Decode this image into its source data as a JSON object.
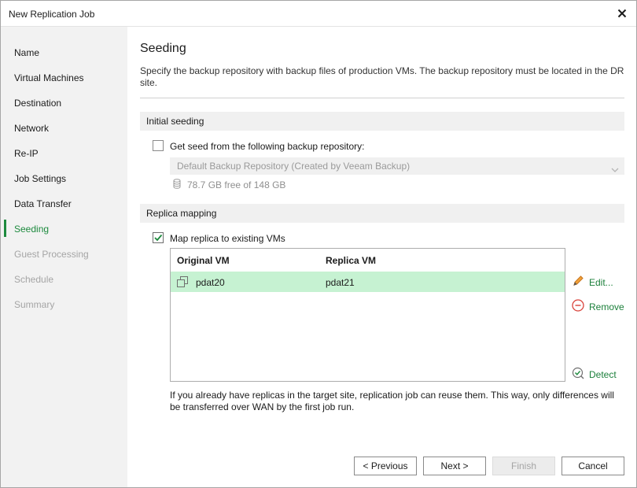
{
  "window": {
    "title": "New Replication Job"
  },
  "sidebar": {
    "items": [
      {
        "label": "Name",
        "state": "normal"
      },
      {
        "label": "Virtual Machines",
        "state": "normal"
      },
      {
        "label": "Destination",
        "state": "normal"
      },
      {
        "label": "Network",
        "state": "normal"
      },
      {
        "label": "Re-IP",
        "state": "normal"
      },
      {
        "label": "Job Settings",
        "state": "normal"
      },
      {
        "label": "Data Transfer",
        "state": "normal"
      },
      {
        "label": "Seeding",
        "state": "active"
      },
      {
        "label": "Guest Processing",
        "state": "disabled"
      },
      {
        "label": "Schedule",
        "state": "disabled"
      },
      {
        "label": "Summary",
        "state": "disabled"
      }
    ]
  },
  "page": {
    "title": "Seeding",
    "description": "Specify the backup repository with backup files of production VMs. The backup repository must be located in the DR site."
  },
  "initial_seeding": {
    "header": "Initial seeding",
    "checkbox_label": "Get seed from the following backup repository:",
    "checked": false,
    "repository_value": "Default Backup Repository (Created by Veeam Backup)",
    "free_space": "78.7 GB free of 148 GB"
  },
  "replica_mapping": {
    "header": "Replica mapping",
    "checkbox_label": "Map replica to existing VMs",
    "checked": true,
    "columns": [
      "Original VM",
      "Replica VM"
    ],
    "rows": [
      {
        "original": "pdat20",
        "replica": "pdat21"
      }
    ],
    "edit_label": "Edit...",
    "remove_label": "Remove",
    "detect_label": "Detect",
    "help_text": "If you already have replicas in the target site, replication job can reuse them. This way, only differences will be transferred over WAN by the first job run."
  },
  "footer": {
    "previous": "< Previous",
    "next": "Next >",
    "finish": "Finish",
    "cancel": "Cancel"
  },
  "colors": {
    "accent": "#1d8a3e",
    "selected_row": "#c6f2d2",
    "remove": "#d9433b"
  }
}
